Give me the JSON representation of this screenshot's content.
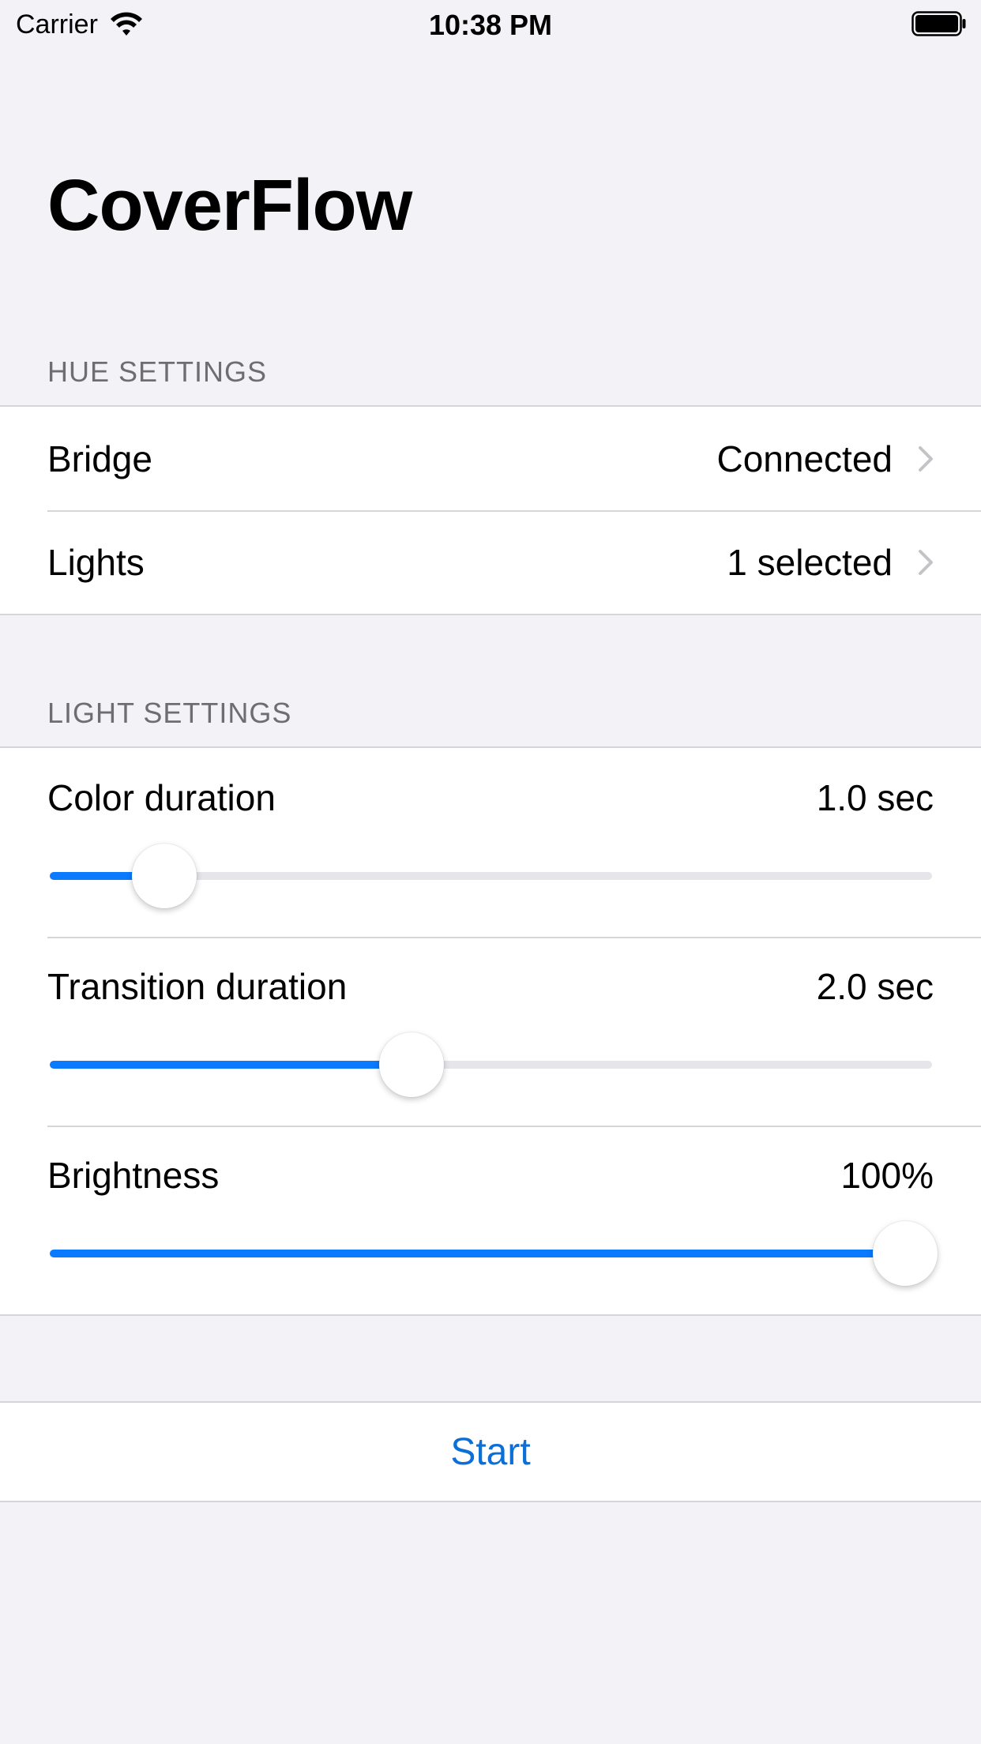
{
  "status_bar": {
    "carrier": "Carrier",
    "time": "10:38 PM",
    "icons": [
      "wifi-icon",
      "battery-icon"
    ]
  },
  "title": "CoverFlow",
  "hue_settings": {
    "header": "HUE SETTINGS",
    "rows": [
      {
        "label": "Bridge",
        "value": "Connected",
        "icon": "chevron-right-icon"
      },
      {
        "label": "Lights",
        "value": "1 selected",
        "icon": "chevron-right-icon"
      }
    ]
  },
  "light_settings": {
    "header": "LIGHT SETTINGS",
    "sliders": [
      {
        "label": "Color duration",
        "value": "1.0 sec",
        "fraction": 0.13
      },
      {
        "label": "Transition duration",
        "value": "2.0 sec",
        "fraction": 0.41
      },
      {
        "label": "Brightness",
        "value": "100%",
        "fraction": 0.97
      }
    ]
  },
  "actions": {
    "start": "Start"
  },
  "colors": {
    "background": "#f2f2f7",
    "accent": "#0a7aff",
    "secondary_text": "#6d6d72",
    "separator": "#d6d6da"
  }
}
